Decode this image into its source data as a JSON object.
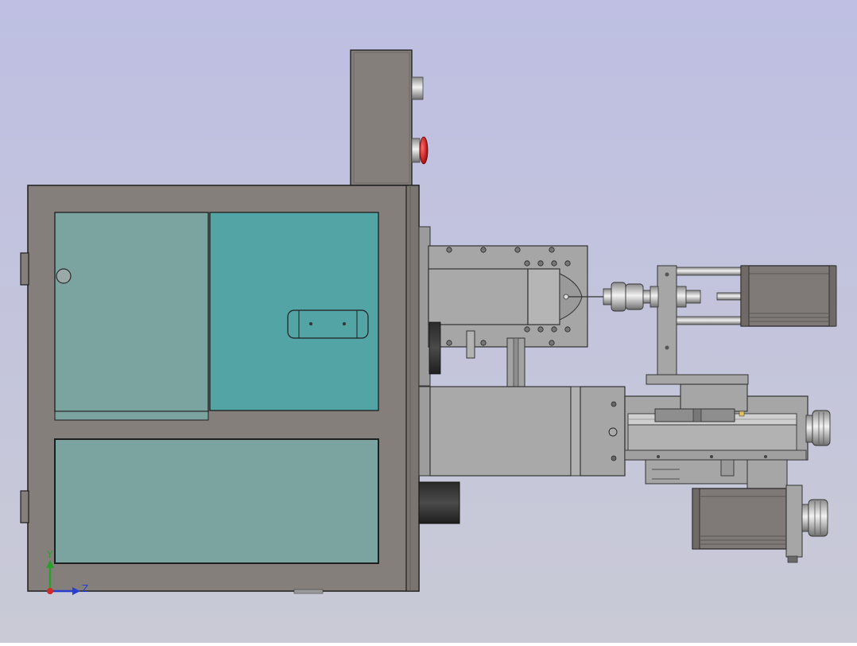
{
  "triad": {
    "y_label": "Y",
    "z_label": "Z"
  },
  "colors": {
    "background_top": "#bebfe2",
    "background_bottom": "#c8c9d6",
    "cabinet": "#857f7b",
    "panel_teal": "#7ba3a0",
    "panel_bright_teal": "#53a4a5",
    "light_steel": "#a9a9a9",
    "motor_dark": "#3a3a3a",
    "estop_red": "#d11a1a",
    "axis_y": "#2aa02a",
    "axis_z": "#2a3fd0",
    "axis_origin": "#d02a2a"
  }
}
